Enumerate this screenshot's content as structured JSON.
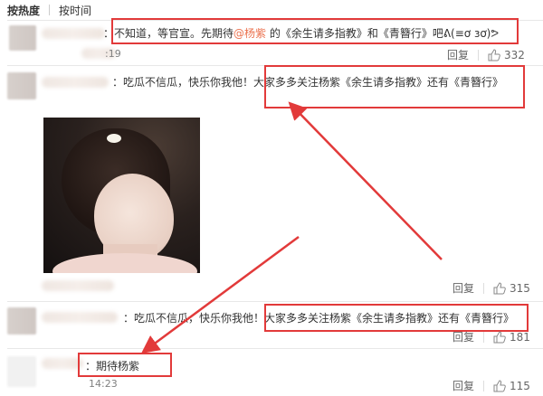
{
  "tabs": {
    "hot": "按热度",
    "time": "按时间"
  },
  "comments": [
    {
      "prefix": "：不知道，等官宣。先期待",
      "mention": "@杨紫",
      "suffix": " 的《余生请多指教》和《青簪行》吧ᕕ(≡ơ ɜơ)ᕗ",
      "time": ":19",
      "likes": "332"
    },
    {
      "prefix": "：吃瓜不信瓜，快乐你我他！",
      "highlight": "大家多多关注杨紫《余生请多指教》还有《青簪行》",
      "likes": "315"
    },
    {
      "prefix": "：吃瓜不信瓜，快乐你我他！",
      "highlight": "大家多多关注杨紫《余生请多指教》还有《青簪行》",
      "likes": "181"
    },
    {
      "prefix": "：期待杨紫",
      "time": "14:23",
      "likes": "115"
    }
  ],
  "reply_label": "回复",
  "colors": {
    "annotation": "#e23a3a",
    "mention": "#eb7350"
  }
}
